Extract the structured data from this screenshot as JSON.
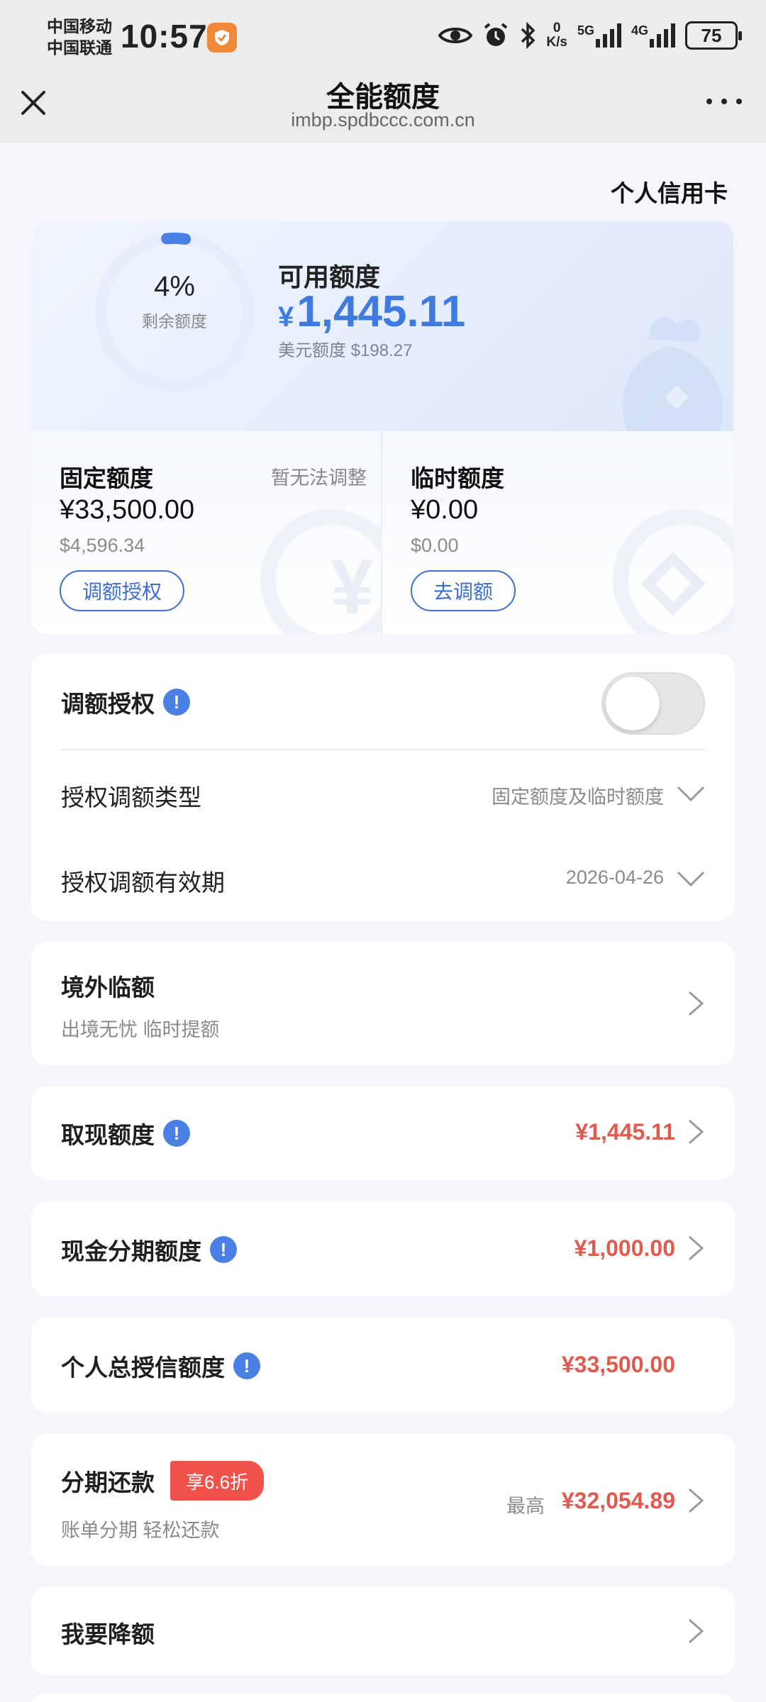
{
  "status_bar": {
    "carrier1": "中国移动",
    "carrier2": "中国联通",
    "time": "10:57",
    "net_speed_value": "0",
    "net_speed_unit": "K/s",
    "signal1": "5G",
    "signal2": "4G",
    "battery": "75"
  },
  "nav": {
    "title": "全能额度",
    "url": "imbp.spdbccc.com.cn"
  },
  "card_type": "个人信用卡",
  "available": {
    "ring_percent": "4%",
    "ring_label": "剩余额度",
    "ring_fraction": 0.04,
    "label": "可用额度",
    "currency": "¥",
    "value": "1,445.11",
    "usd": "美元额度 $198.27"
  },
  "fixed": {
    "title": "固定额度",
    "note": "暂无法调整",
    "value": "¥33,500.00",
    "usd": "$4,596.34",
    "button": "调额授权"
  },
  "temp": {
    "title": "临时额度",
    "value": "¥0.00",
    "usd": "$0.00",
    "button": "去调额"
  },
  "auth": {
    "title": "调额授权",
    "toggle_on": false,
    "type_label": "授权调额类型",
    "type_value": "固定额度及临时额度",
    "period_label": "授权调额有效期",
    "period_value": "2026-04-26"
  },
  "overseas": {
    "title": "境外临额",
    "subtitle": "出境无忧 临时提额"
  },
  "cash": {
    "title": "取现额度",
    "value": "¥1,445.11"
  },
  "cash_installment": {
    "title": "现金分期额度",
    "value": "¥1,000.00"
  },
  "total_credit": {
    "title": "个人总授信额度",
    "value": "¥33,500.00"
  },
  "installment": {
    "title": "分期还款",
    "badge": "享6.6折",
    "subtitle": "账单分期 轻松还款",
    "max_label": "最高",
    "value": "¥32,054.89"
  },
  "reduce": {
    "title": "我要降额"
  },
  "colors": {
    "accent_blue": "#3f7ae0",
    "red": "#e05a4e",
    "badge_red": "#f0524a"
  }
}
